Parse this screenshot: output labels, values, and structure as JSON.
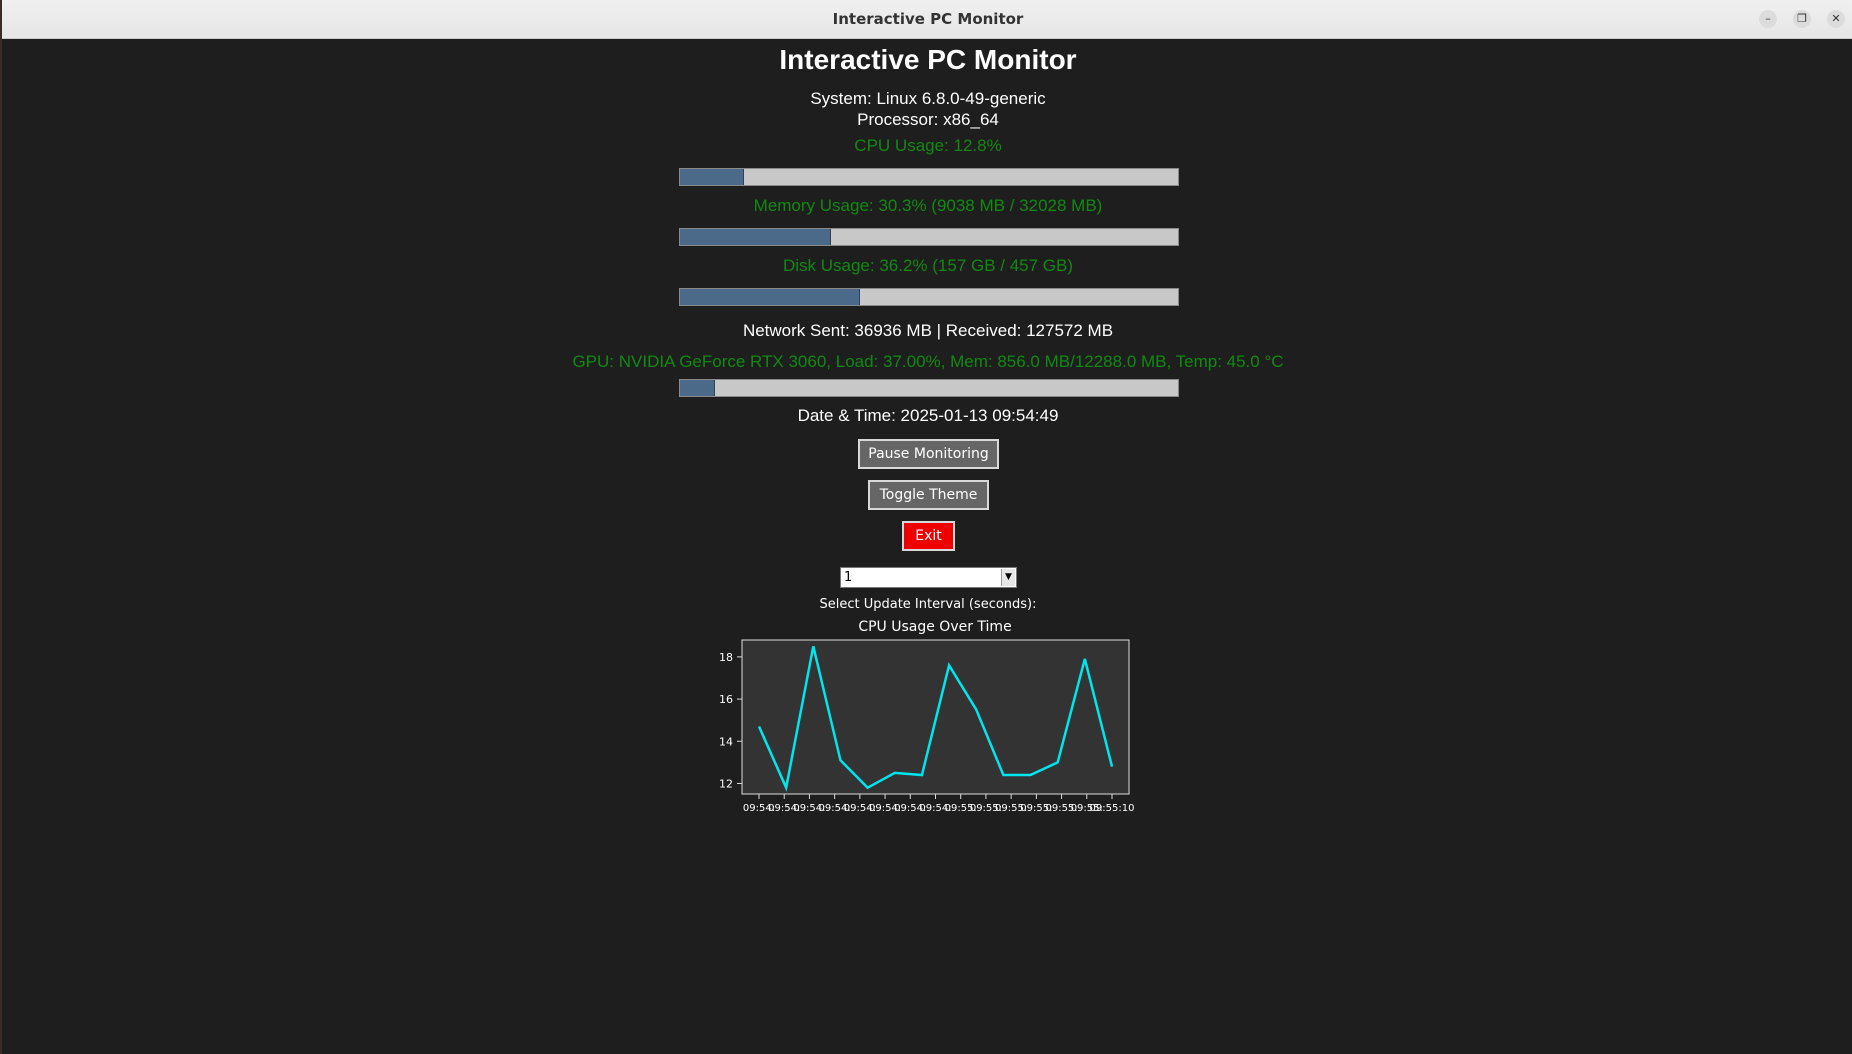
{
  "window": {
    "title": "Interactive PC Monitor"
  },
  "header": {
    "title": "Interactive PC Monitor"
  },
  "system": {
    "system_text": "System: Linux 6.8.0-49-generic",
    "processor_text": "Processor: x86_64"
  },
  "cpu": {
    "label": "CPU Usage: 12.8%",
    "percent": 12.8
  },
  "memory": {
    "label": "Memory Usage: 30.3% (9038 MB / 32028 MB)",
    "percent": 30.3
  },
  "disk": {
    "label": "Disk Usage: 36.2% (157 GB / 457 GB)",
    "percent": 36.2
  },
  "network": {
    "label": "Network Sent: 36936 MB | Received: 127572 MB"
  },
  "gpu": {
    "label": "GPU: NVIDIA GeForce RTX 3060, Load: 37.00%, Mem: 856.0 MB/12288.0 MB, Temp: 45.0 °C",
    "bar_percent": 7
  },
  "datetime": {
    "label": "Date & Time: 2025-01-13 09:54:49"
  },
  "buttons": {
    "pause": "Pause Monitoring",
    "toggle_theme": "Toggle Theme",
    "exit": "Exit"
  },
  "interval": {
    "selected": "1",
    "label": "Select Update Interval (seconds):"
  },
  "colors": {
    "accent_green": "#108a10",
    "bar_fill": "#4b6a8a",
    "exit_red": "#ee0000",
    "line": "#00e5ee"
  },
  "chart_data": {
    "type": "line",
    "title": "CPU Usage Over Time",
    "xlabel": "",
    "ylabel": "",
    "x_tick_labels": [
      "09:54:",
      "09:54:",
      "09:54:",
      "09:54:",
      "09:54:",
      "09:54:",
      "09:54:",
      "09:54:",
      "09:55:",
      "09:55:",
      "09:55:",
      "09:55:",
      "09:55:",
      "09:55:",
      "09:55:10"
    ],
    "yticks": [
      12,
      14,
      16,
      18
    ],
    "ylim": [
      11.5,
      18.8
    ],
    "series": [
      {
        "values": [
          14.7,
          11.8,
          18.5,
          13.1,
          11.8,
          12.5,
          12.4,
          17.6,
          15.5,
          12.4,
          12.4,
          13.0,
          17.9,
          12.8
        ]
      }
    ],
    "grid": false
  }
}
